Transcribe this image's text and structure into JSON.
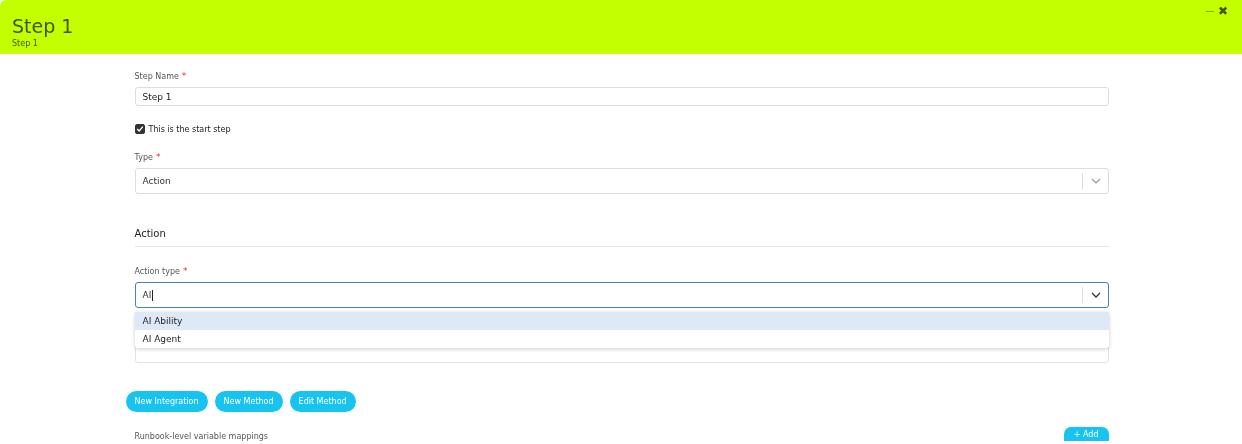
{
  "header": {
    "title": "Step 1",
    "subtitle": "Step 1",
    "minimize": "—",
    "close": "✖"
  },
  "step_name": {
    "label": "Step Name",
    "mark": "*",
    "value": "Step 1"
  },
  "start_step": {
    "label": "This is the start step",
    "checked": true
  },
  "type": {
    "label": "Type",
    "mark": "*",
    "value": "Action"
  },
  "section": {
    "title": "Action"
  },
  "action_type": {
    "label": "Action type",
    "mark": "*",
    "value": "AI",
    "focused": true,
    "options": [
      {
        "label": "AI Ability",
        "selected": true
      },
      {
        "label": "AI Agent",
        "selected": false
      }
    ]
  },
  "buttons": [
    "New Integration",
    "New Method",
    "Edit Method"
  ],
  "mappings": {
    "label": "Runbook-level variable mappings",
    "add": "+ Add"
  }
}
